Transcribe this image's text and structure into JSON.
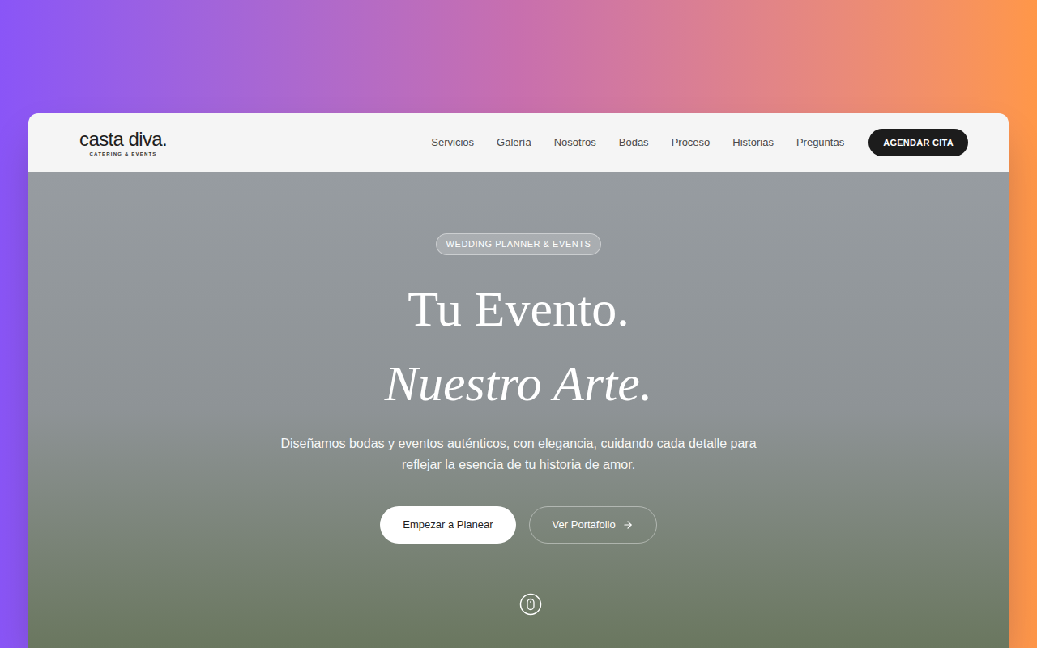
{
  "header": {
    "logo": {
      "name": "casta diva.",
      "tagline": "CATERING & EVENTS"
    },
    "nav": [
      {
        "label": "Servicios"
      },
      {
        "label": "Galería"
      },
      {
        "label": "Nosotros"
      },
      {
        "label": "Bodas"
      },
      {
        "label": "Proceso"
      },
      {
        "label": "Historias"
      },
      {
        "label": "Preguntas"
      }
    ],
    "cta": "AGENDAR CITA"
  },
  "hero": {
    "badge": "WEDDING PLANNER & EVENTS",
    "title_line_1": "Tu Evento.",
    "title_line_2": "Nuestro Arte.",
    "description": "Diseñamos bodas y eventos auténticos, con elegancia, cuidando cada detalle para reflejar la esencia de tu historia de amor.",
    "primary_button": "Empezar a Planear",
    "secondary_button": "Ver Portafolio"
  }
}
